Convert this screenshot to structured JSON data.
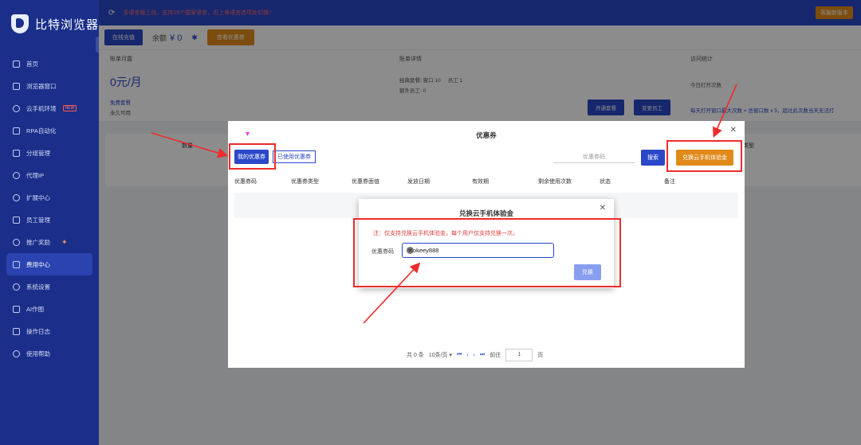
{
  "app": {
    "name": "比特浏览器"
  },
  "topbar": {
    "notice": "多语言版上线，支持15个国家语言，右上角语言选项处切换！",
    "version_button": "客服新版本"
  },
  "toolbar": {
    "recharge_button": "在线充值",
    "balance_label": "余额",
    "balance_value": "¥ 0",
    "coupon_button": "查看优惠券"
  },
  "sidebar": {
    "items": [
      {
        "label": "首页"
      },
      {
        "label": "浏览器窗口"
      },
      {
        "label": "云手机环境",
        "badge": "NEW"
      },
      {
        "label": "RPA自动化"
      },
      {
        "label": "分组管理"
      },
      {
        "label": "代理IP"
      },
      {
        "label": "扩展中心"
      },
      {
        "label": "员工管理"
      },
      {
        "label": "推广奖励"
      },
      {
        "label": "费用中心"
      },
      {
        "label": "系统设置"
      },
      {
        "label": "AI作图"
      },
      {
        "label": "操作日志"
      },
      {
        "label": "使用帮助"
      }
    ],
    "active_index": 9
  },
  "stats": {
    "monthly": {
      "title": "账单月露",
      "value": "0元/月",
      "package": "免费套餐",
      "validity": "永久可用"
    },
    "detail": {
      "title": "账单详情",
      "line1": "经典套餐: 窗口 10",
      "line1b": "员工 1",
      "line2": "额外员工: 0",
      "open_button": "开通套餐",
      "change_button": "变更员工"
    },
    "visits": {
      "title": "访问统计",
      "today": "今日打开次数",
      "note": "每天打开窗口最大次数 = 总窗口数 x 5，超过此次数当天无法打"
    }
  },
  "content": {
    "col_a": "数量",
    "col_b": "类型"
  },
  "coupon_dialog": {
    "title": "优惠券",
    "tab_mine": "我的优惠券",
    "tab_used": "已使用优惠券",
    "search_placeholder": "优惠券码",
    "search_button": "搜索",
    "redeem_button": "兑换云手机体验金",
    "columns": [
      "优惠券码",
      "优惠券类型",
      "优惠券面值",
      "发放日期",
      "有效期",
      "剩余使用次数",
      "状态",
      "备注"
    ],
    "pager": {
      "total": "共 0 条",
      "page_size": "10条/页",
      "goto_label": "前往",
      "page": "1",
      "page_unit": "页"
    }
  },
  "redeem_dialog": {
    "title": "兑换云手机体验金",
    "note": "注：仅支持兑换云手机体验金，每个用户仅支持兑换一次。",
    "code_label": "优惠券码",
    "code_value": "kookeey888",
    "submit": "兑换"
  }
}
